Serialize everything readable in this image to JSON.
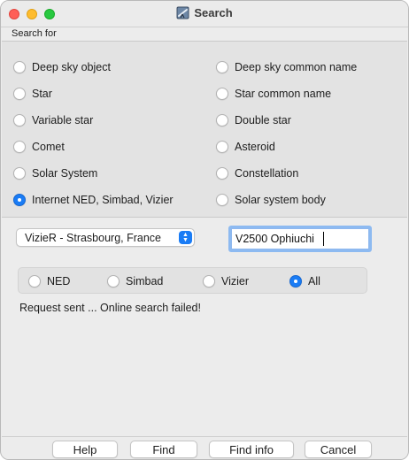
{
  "window": {
    "title": "Search",
    "app_icon": "telescope-icon"
  },
  "search_for": {
    "label": "Search for",
    "left_options": [
      {
        "label": "Deep sky object",
        "checked": false
      },
      {
        "label": "Star",
        "checked": false
      },
      {
        "label": "Variable star",
        "checked": false
      },
      {
        "label": "Comet",
        "checked": false
      },
      {
        "label": "Solar System",
        "checked": false
      },
      {
        "label": "Internet NED, Simbad, Vizier",
        "checked": true
      }
    ],
    "right_options": [
      {
        "label": "Deep sky common name",
        "checked": false
      },
      {
        "label": "Star common name",
        "checked": false
      },
      {
        "label": "Double star",
        "checked": false
      },
      {
        "label": "Asteroid",
        "checked": false
      },
      {
        "label": "Constellation",
        "checked": false
      },
      {
        "label": "Solar system body",
        "checked": false
      }
    ]
  },
  "server_select": {
    "value": "VizieR - Strasbourg, France"
  },
  "query_input": {
    "value": "V2500 Ophiuchi"
  },
  "catalogs": [
    {
      "label": "NED",
      "checked": false
    },
    {
      "label": "Simbad",
      "checked": false
    },
    {
      "label": "Vizier",
      "checked": false
    },
    {
      "label": "All",
      "checked": true
    }
  ],
  "status_text": "Request sent ... Online search failed!",
  "buttons": {
    "help": "Help",
    "find": "Find",
    "find_info": "Find info",
    "cancel": "Cancel"
  },
  "colors": {
    "accent": "#1a7cf5",
    "close": "#ff5f57",
    "minimize": "#febc2e",
    "maximize": "#28c840"
  }
}
